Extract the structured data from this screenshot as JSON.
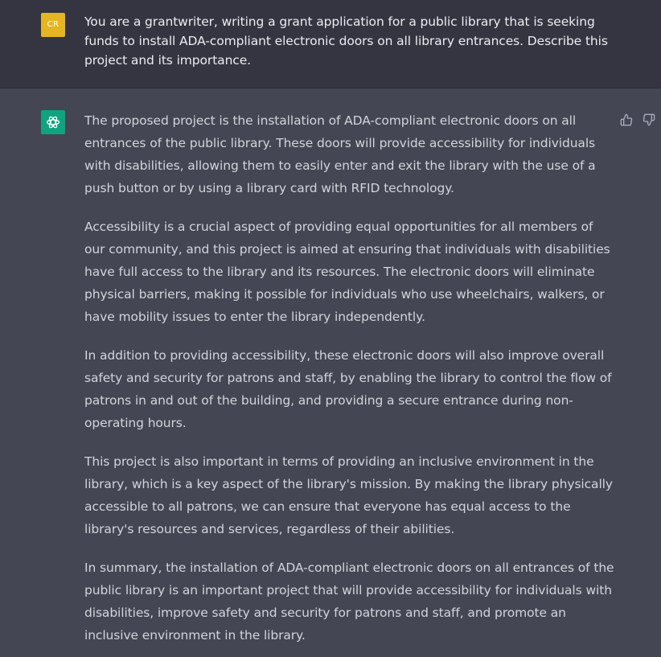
{
  "user_message": {
    "avatar_initials": "CR",
    "avatar_color": "#e5b622",
    "text": "You are a grantwriter, writing a grant application for a public library that is seeking funds to install ADA-compliant electronic doors on all library entrances. Describe this project and its importance."
  },
  "assistant_message": {
    "avatar_icon": "openai-logo-icon",
    "avatar_color": "#10a37f",
    "paragraphs": [
      "The proposed project is the installation of ADA-compliant electronic doors on all entrances of the public library. These doors will provide accessibility for individuals with disabilities, allowing them to easily enter and exit the library with the use of a push button or by using a library card with RFID technology.",
      "Accessibility is a crucial aspect of providing equal opportunities for all members of our community, and this project is aimed at ensuring that individuals with disabilities have full access to the library and its resources. The electronic doors will eliminate physical barriers, making it possible for individuals who use wheelchairs, walkers, or have mobility issues to enter the library independently.",
      "In addition to providing accessibility, these electronic doors will also improve overall safety and security for patrons and staff, by enabling the library to control the flow of patrons in and out of the building, and providing a secure entrance during non-operating hours.",
      "This project is also important in terms of providing an inclusive environment in the library, which is a key aspect of the library's mission. By making the library physically accessible to all patrons, we can ensure that everyone has equal access to the library's resources and services, regardless of their abilities.",
      "In summary, the installation of ADA-compliant electronic doors on all entrances of the public library is an important project that will provide accessibility for individuals with disabilities, improve safety and security for patrons and staff, and promote an inclusive environment in the library."
    ],
    "feedback": {
      "thumbs_up_icon": "thumbs-up-icon",
      "thumbs_down_icon": "thumbs-down-icon"
    }
  }
}
